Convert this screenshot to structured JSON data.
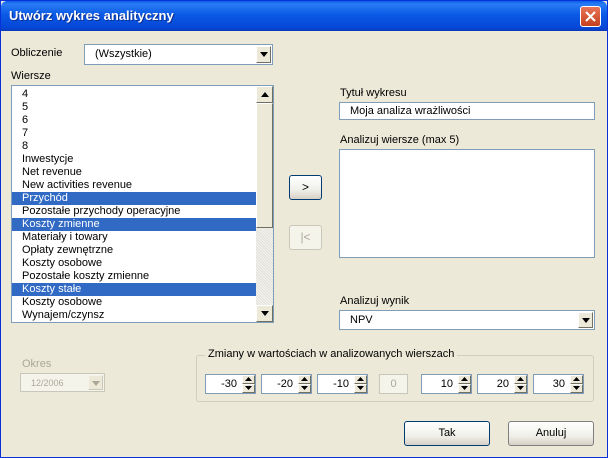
{
  "window": {
    "title": "Utwórz wykres analityczny"
  },
  "calculation": {
    "label": "Obliczenie",
    "value": "(Wszystkie)"
  },
  "rows": {
    "label": "Wiersze",
    "items": [
      {
        "label": "4",
        "selected": false
      },
      {
        "label": "5",
        "selected": false
      },
      {
        "label": "6",
        "selected": false
      },
      {
        "label": "7",
        "selected": false
      },
      {
        "label": "8",
        "selected": false
      },
      {
        "label": "Inwestycje",
        "selected": false
      },
      {
        "label": "Net revenue",
        "selected": false
      },
      {
        "label": "New activities revenue",
        "selected": false
      },
      {
        "label": "Przychód",
        "selected": true
      },
      {
        "label": "Pozostałe przychody operacyjne",
        "selected": false
      },
      {
        "label": "Koszty zmienne",
        "selected": true
      },
      {
        "label": "Materiały i towary",
        "selected": false
      },
      {
        "label": "Opłaty zewnętrzne",
        "selected": false
      },
      {
        "label": "Koszty osobowe",
        "selected": false
      },
      {
        "label": "Pozostałe koszty zmienne",
        "selected": false
      },
      {
        "label": "Koszty stałe",
        "selected": true
      },
      {
        "label": "Koszty osobowe",
        "selected": false
      },
      {
        "label": "Wynajem/czynsz",
        "selected": false
      }
    ]
  },
  "chart_title": {
    "label": "Tytuł wykresu",
    "value": "Moja analiza wrażliwości"
  },
  "analyze_rows": {
    "label": "Analizuj wiersze (max 5)",
    "items": []
  },
  "buttons": {
    "add": ">",
    "remove": "|<",
    "ok": "Tak",
    "cancel": "Anuluj"
  },
  "analyze_result": {
    "label": "Analizuj wynik",
    "value": "NPV"
  },
  "period": {
    "label": "Okres",
    "value": "12/2006"
  },
  "changes": {
    "label": "Zmiany w wartościach w analizowanych wierszach",
    "values": [
      "-30",
      "-20",
      "-10",
      "0",
      "10",
      "20",
      "30"
    ]
  },
  "colors": {
    "selection": "#316ac5",
    "titlebar": "#0a5ee8",
    "dialog": "#ece9d8"
  }
}
